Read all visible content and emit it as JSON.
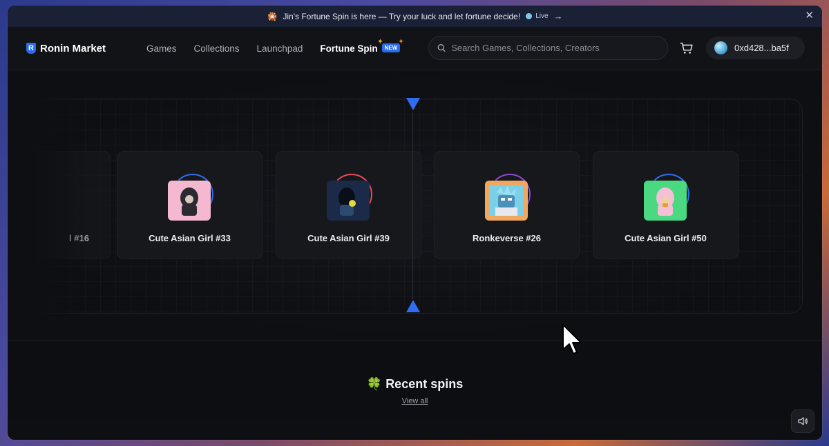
{
  "banner": {
    "emoji": "🎇",
    "text": "Jin's Fortune Spin is here — Try your luck and let fortune decide!",
    "live_label": "Live",
    "arrow": "→",
    "close": "✕"
  },
  "nav": {
    "brand": "Ronin Market",
    "brand_mark": "R",
    "items": [
      {
        "label": "Games"
      },
      {
        "label": "Collections"
      },
      {
        "label": "Launchpad"
      }
    ],
    "active_item": {
      "label": "Fortune Spin",
      "badge": "NEW"
    }
  },
  "search": {
    "placeholder": "Search Games, Collections, Creators"
  },
  "wallet": {
    "address": "0xd428...ba5f"
  },
  "spinner": {
    "cards": [
      {
        "name": "l #16",
        "partial": true
      },
      {
        "name": "Cute Asian Girl #33",
        "thumb_bg": "#f4b8d0",
        "ring": "#2f6df0"
      },
      {
        "name": "Cute Asian Girl #39",
        "thumb_bg": "#1a2a48",
        "ring": "#e84a5a"
      },
      {
        "name": "Ronkeverse #26",
        "thumb_bg": "#f0a860",
        "ring": "#8a4ad0"
      },
      {
        "name": "Cute Asian Girl #50",
        "thumb_bg": "#4ad880",
        "ring": "#2f6df0"
      }
    ],
    "pointer_color": "#2f6df0"
  },
  "recent": {
    "icon": "🍀",
    "title": "Recent spins",
    "view_all": "View all"
  },
  "colors": {
    "accent": "#2f6df0",
    "background": "#0e0f12"
  }
}
